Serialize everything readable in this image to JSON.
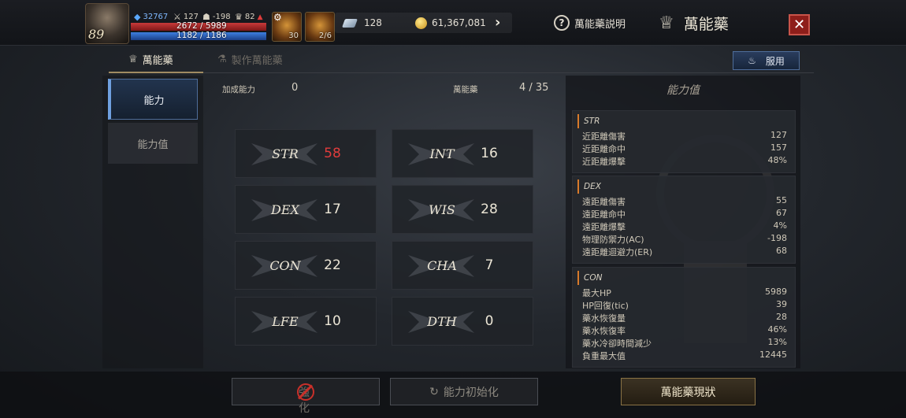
{
  "hud": {
    "level": "89",
    "exp": "32767",
    "stat_attack": "127",
    "stat_defense": "-198",
    "stat_trophy": "82",
    "hp": "2672 / 5989",
    "mp": "1182 / 1186",
    "slot1_count": "30",
    "slot2_count": "2/6",
    "gems": "128",
    "gold": "61,367,081",
    "help_label": "萬能藥説明",
    "title": "萬能藥",
    "close_glyph": "✕"
  },
  "tabs": [
    {
      "label": "萬能藥",
      "active": true
    },
    {
      "label": "製作萬能藥",
      "active": false
    }
  ],
  "use_button": "服用",
  "sidenav": [
    {
      "label": "能力",
      "active": true
    },
    {
      "label": "能力值",
      "active": false
    }
  ],
  "info": {
    "bonus_label": "加成能力",
    "bonus_value": "0",
    "elixir_label": "萬能藥",
    "elixir_value": "4 / 35"
  },
  "stats": [
    {
      "name": "STR",
      "value": "58",
      "highlight": "#e03c3c"
    },
    {
      "name": "INT",
      "value": "16"
    },
    {
      "name": "DEX",
      "value": "17"
    },
    {
      "name": "WIS",
      "value": "28"
    },
    {
      "name": "CON",
      "value": "22"
    },
    {
      "name": "CHA",
      "value": "7"
    },
    {
      "name": "LFE",
      "value": "10"
    },
    {
      "name": "DTH",
      "value": "0"
    }
  ],
  "panel": {
    "title": "能力值",
    "groups": [
      {
        "name": "STR",
        "rows": [
          {
            "k": "近距離傷害",
            "v": "127"
          },
          {
            "k": "近距離命中",
            "v": "157"
          },
          {
            "k": "近距離爆擊",
            "v": "48%"
          }
        ]
      },
      {
        "name": "DEX",
        "rows": [
          {
            "k": "遠距離傷害",
            "v": "55"
          },
          {
            "k": "遠距離命中",
            "v": "67"
          },
          {
            "k": "遠距離爆擊",
            "v": "4%"
          },
          {
            "k": "物理防禦力(AC)",
            "v": "-198"
          },
          {
            "k": "遠距離迴避力(ER)",
            "v": "68"
          }
        ]
      },
      {
        "name": "CON",
        "rows": [
          {
            "k": "最大HP",
            "v": "5989"
          },
          {
            "k": "HP回復(tic)",
            "v": "39"
          },
          {
            "k": "藥水恢復量",
            "v": "28"
          },
          {
            "k": "藥水恢復率",
            "v": "46%"
          },
          {
            "k": "藥水冷卻時間減少",
            "v": "13%"
          },
          {
            "k": "負重最大值",
            "v": "12445"
          }
        ]
      }
    ]
  },
  "bottom": {
    "disabled_label": "強化",
    "reset_label": "能力初始化",
    "status_label": "萬能藥現狀"
  },
  "colors": {
    "accent": "#4e6d9a",
    "danger": "#8e1e1a",
    "highlight": "#e03c3c",
    "gold_border": "#8a7345"
  }
}
